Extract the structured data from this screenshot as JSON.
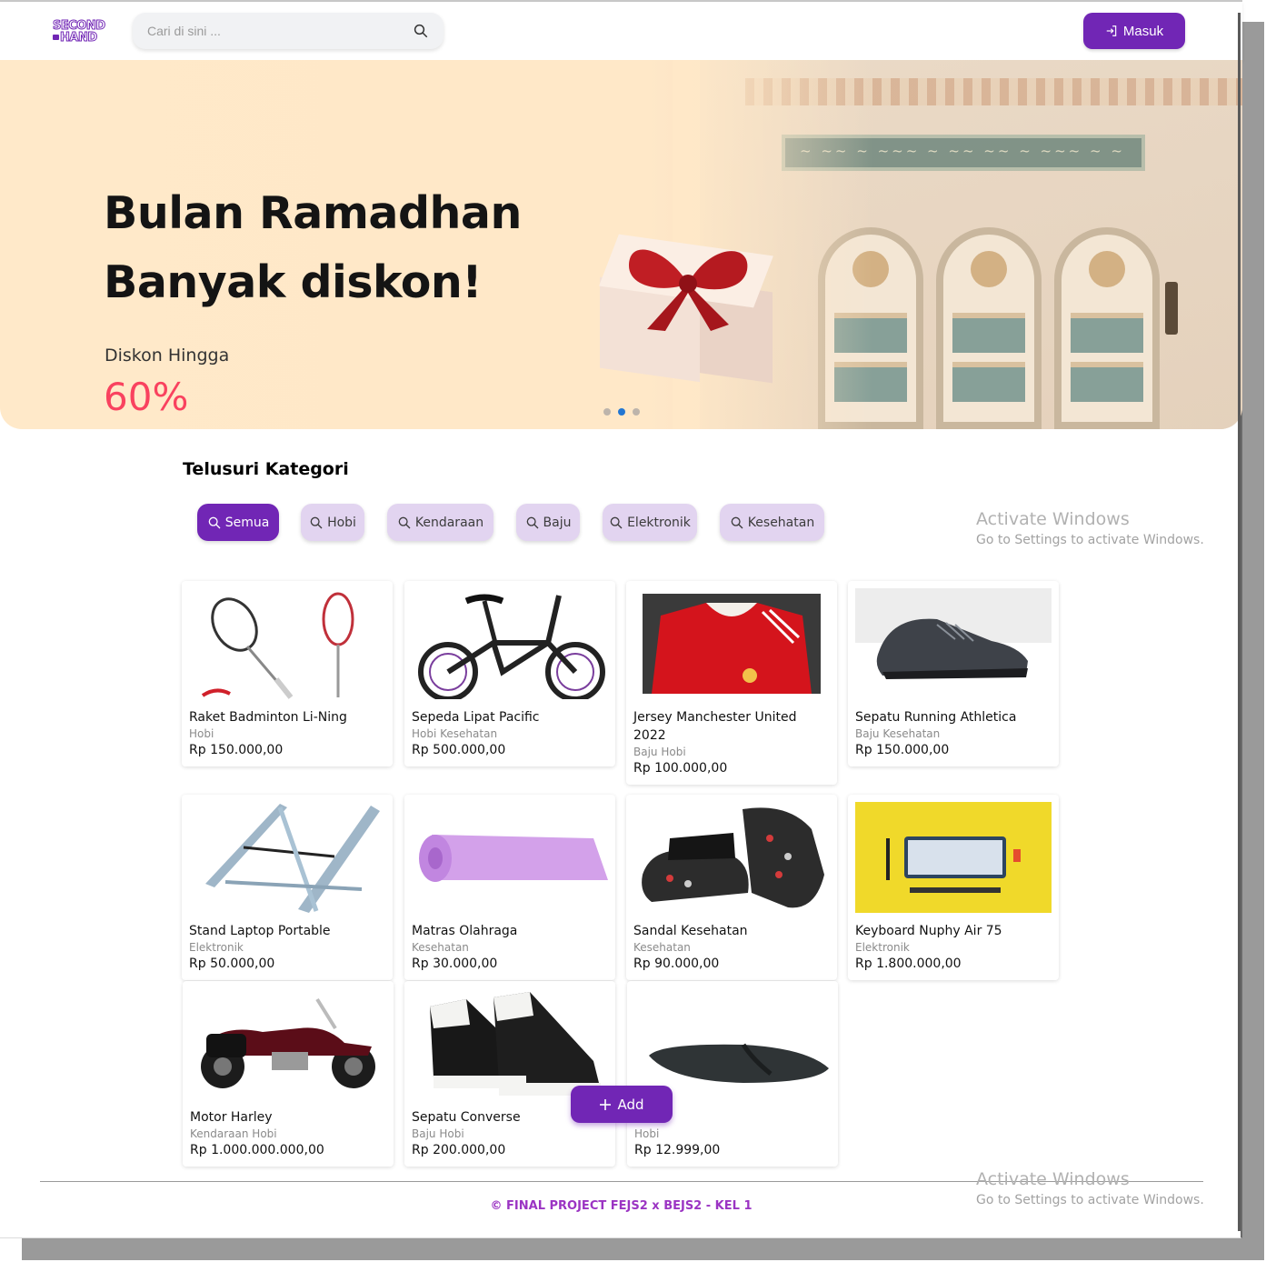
{
  "header": {
    "logo_line1": "SECOND",
    "logo_line2": "HAND",
    "search_placeholder": "Cari di sini ...",
    "login_label": "Masuk"
  },
  "banner": {
    "title_line1": "Bulan Ramadhan",
    "title_line2": "Banyak diskon!",
    "subtitle": "Diskon Hingga",
    "percent": "60%",
    "active_slide": 2,
    "slide_count": 3
  },
  "categories": {
    "title": "Telusuri Kategori",
    "items": [
      "Semua",
      "Hobi",
      "Kendaraan",
      "Baju",
      "Elektronik",
      "Kesehatan"
    ],
    "active": "Semua"
  },
  "products": [
    {
      "name": "Raket Badminton Li-Ning",
      "category": "Hobi",
      "price": "Rp 150.000,00",
      "image": "badminton-racket"
    },
    {
      "name": "Sepeda Lipat Pacific",
      "category": "Hobi Kesehatan",
      "price": "Rp 500.000,00",
      "image": "folding-bike"
    },
    {
      "name": "Jersey Manchester United 2022",
      "category": "Baju Hobi",
      "price": "Rp 100.000,00",
      "image": "red-jersey"
    },
    {
      "name": "Sepatu Running Athletica",
      "category": "Baju Kesehatan",
      "price": "Rp 150.000,00",
      "image": "running-shoe"
    },
    {
      "name": "Stand Laptop Portable",
      "category": "Elektronik",
      "price": "Rp 50.000,00",
      "image": "laptop-stand"
    },
    {
      "name": "Matras Olahraga",
      "category": "Kesehatan",
      "price": "Rp 30.000,00",
      "image": "yoga-mat"
    },
    {
      "name": "Sandal Kesehatan",
      "category": "Kesehatan",
      "price": "Rp 90.000,00",
      "image": "massage-sandals"
    },
    {
      "name": "Keyboard Nuphy Air 75",
      "category": "Elektronik",
      "price": "Rp 1.800.000,00",
      "image": "keyboard"
    },
    {
      "name": "Motor Harley",
      "category": "Kendaraan Hobi",
      "price": "Rp 1.000.000.000,00",
      "image": "motorcycle"
    },
    {
      "name": "Sepatu Converse",
      "category": "Baju Hobi",
      "price": "Rp 200.000,00",
      "image": "converse-sneakers"
    },
    {
      "name": "",
      "category": "Hobi",
      "price": "Rp 12.999,00",
      "image": "flip-flop"
    }
  ],
  "add_button": {
    "label": "Add"
  },
  "footer": {
    "text": "© FINAL PROJECT FEJS2 x BEJS2 - KEL 1"
  },
  "watermark": {
    "line1": "Activate Windows",
    "line2": "Go to Settings to activate Windows."
  },
  "colors": {
    "primary": "#7126b5",
    "chip_bg": "#e2d4f0",
    "accent_red": "#f9425f",
    "footer": "#9b34c3"
  }
}
